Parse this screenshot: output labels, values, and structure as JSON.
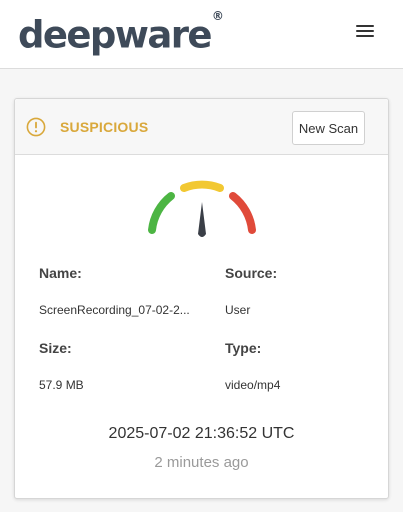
{
  "header": {
    "logo_text": "deepware",
    "logo_mark": "®",
    "menu_icon": "hamburger-menu-icon"
  },
  "result": {
    "status_icon": "warning-circle-icon",
    "status": "SUSPICIOUS",
    "status_color": "#d9a83b",
    "new_scan_label": "New Scan",
    "gauge_colors": {
      "left": "#4cb543",
      "middle": "#f2c832",
      "right": "#e04a3a",
      "needle": "#3a3f47"
    },
    "fields": {
      "name_label": "Name:",
      "name_value": "ScreenRecording_07-02-2...",
      "source_label": "Source:",
      "source_value": "User",
      "size_label": "Size:",
      "size_value": "57.9 MB",
      "type_label": "Type:",
      "type_value": "video/mp4"
    },
    "timestamp": "2025-07-02 21:36:52 UTC",
    "relative_time": "2 minutes ago"
  }
}
